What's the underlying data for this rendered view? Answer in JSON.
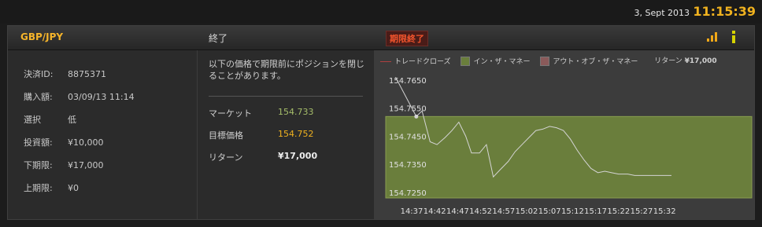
{
  "clock": {
    "date": "3, Sept 2013",
    "time": "11:15:39"
  },
  "header": {
    "pair": "GBP/JPY",
    "status": "終了",
    "expired_badge": "期限終了"
  },
  "details": [
    {
      "label": "決済ID:",
      "value": "8875371"
    },
    {
      "label": "購入額:",
      "value": "03/09/13 11:14"
    },
    {
      "label": "選択",
      "value": "低"
    },
    {
      "label": "投資額:",
      "value": "¥10,000"
    },
    {
      "label": "下期限:",
      "value": "¥17,000"
    },
    {
      "label": "上期限:",
      "value": "¥0"
    }
  ],
  "middle": {
    "note": "以下の価格で期限前にポジションを閉じることがあります。",
    "market_label": "マーケット",
    "market_value": "154.733",
    "target_label": "目標価格",
    "target_value": "154.752",
    "return_label": "リターン",
    "return_value": "¥17,000"
  },
  "legend": {
    "trade_close": "トレードクローズ",
    "in_the_money": "イン・ザ・マネー",
    "out_of_money": "アウト・オブ・ザ・マネー",
    "return_label": "リターン",
    "return_value": "¥17,000"
  },
  "colors": {
    "accent": "#f0b21f",
    "market": "#a6be6a",
    "target": "#f0b21f",
    "in_money": "#6a7e3c",
    "out_money": "#8a5a5a",
    "expired": "#f2542d"
  },
  "chart_data": {
    "type": "line",
    "y_ticks": [
      "154.7650",
      "154.7550",
      "154.7450",
      "154.7350",
      "154.7250"
    ],
    "x_ticks": [
      "14:37",
      "14:42",
      "14:47",
      "14:52",
      "14:57",
      "15:02",
      "15:07",
      "15:12",
      "15:17",
      "15:22",
      "15:27",
      "15:32"
    ],
    "ylim": [
      154.723,
      154.77
    ],
    "in_money_band": [
      154.723,
      154.752
    ],
    "trade_close_point": [
      0.2,
      154.752
    ],
    "series": [
      {
        "x": [
          -0.7,
          0.2,
          0.45,
          0.8,
          1.1,
          1.45,
          1.75,
          2.05,
          2.35,
          2.6,
          2.95,
          3.25,
          3.55,
          3.9,
          4.2,
          4.5,
          4.8,
          5.1,
          5.4,
          5.7,
          6.0,
          6.3,
          6.6,
          6.9,
          7.2,
          7.5,
          7.8,
          8.1,
          8.4,
          8.7,
          9.0,
          9.4,
          9.7,
          10.0,
          10.3,
          10.8,
          11.3
        ],
        "y": [
          154.766,
          154.752,
          154.754,
          154.743,
          154.742,
          154.7445,
          154.747,
          154.75,
          154.745,
          154.739,
          154.739,
          154.742,
          154.7305,
          154.7335,
          154.736,
          154.7395,
          154.742,
          154.7445,
          154.747,
          154.7475,
          154.7485,
          154.748,
          154.747,
          154.744,
          154.74,
          154.7365,
          154.7335,
          154.732,
          154.7325,
          154.732,
          154.7315,
          154.7315,
          154.731,
          154.731,
          154.731,
          154.731,
          154.731
        ]
      }
    ]
  }
}
